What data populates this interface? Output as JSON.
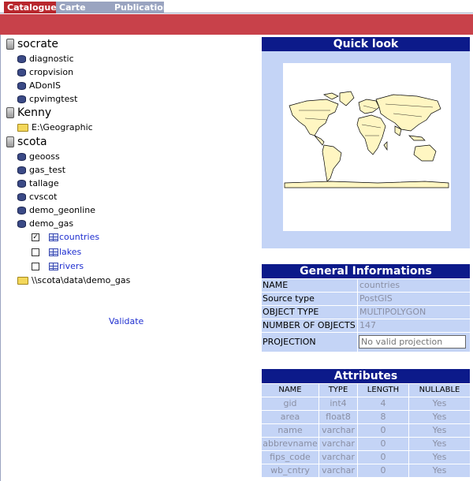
{
  "tabs": [
    {
      "label": "Catalogue",
      "active": true
    },
    {
      "label": "Carte",
      "active": false
    },
    {
      "label": "Publication",
      "active": false
    }
  ],
  "tree": {
    "servers": [
      {
        "name": "socrate",
        "children": [
          "diagnostic",
          "cropvision",
          "ADonIS",
          "cpvimgtest"
        ]
      },
      {
        "name": "Kenny",
        "children": [
          "E:\\Geographic"
        ]
      },
      {
        "name": "scota",
        "children": [
          "geooss",
          "gas_test",
          "tallage",
          "cvscot",
          "demo_geonline",
          "demo_gas"
        ]
      }
    ],
    "layers": [
      {
        "name": "countries",
        "checked": true
      },
      {
        "name": "lakes",
        "checked": false
      },
      {
        "name": "rivers",
        "checked": false
      }
    ],
    "folder_path": "\\\\scota\\data\\demo_gas",
    "validate_label": "Validate"
  },
  "quick_look": {
    "title": "Quick look"
  },
  "general": {
    "title": "General Informations",
    "rows": [
      {
        "key": "NAME",
        "value": "countries"
      },
      {
        "key": "Source type",
        "value": "PostGIS"
      },
      {
        "key": "OBJECT TYPE",
        "value": "MULTIPOLYGON"
      },
      {
        "key": "NUMBER OF OBJECTS",
        "value": "147"
      },
      {
        "key": "PROJECTION",
        "value": ""
      }
    ],
    "projection_placeholder": "No valid projection"
  },
  "attributes": {
    "title": "Attributes",
    "headers": [
      "NAME",
      "TYPE",
      "LENGTH",
      "NULLABLE"
    ],
    "rows": [
      [
        "gid",
        "int4",
        "4",
        "Yes"
      ],
      [
        "area",
        "float8",
        "8",
        "Yes"
      ],
      [
        "name",
        "varchar",
        "0",
        "Yes"
      ],
      [
        "abbrevname",
        "varchar",
        "0",
        "Yes"
      ],
      [
        "fips_code",
        "varchar",
        "0",
        "Yes"
      ],
      [
        "wb_cntry",
        "varchar",
        "0",
        "Yes"
      ]
    ]
  },
  "colors": {
    "tab_active": "#b8272d",
    "tab_inactive": "#9aa4c0",
    "header_bar": "#c8414a",
    "panel_head": "#0c1a8a",
    "panel_bg": "#c4d4f6",
    "link": "#1f2fd0"
  }
}
